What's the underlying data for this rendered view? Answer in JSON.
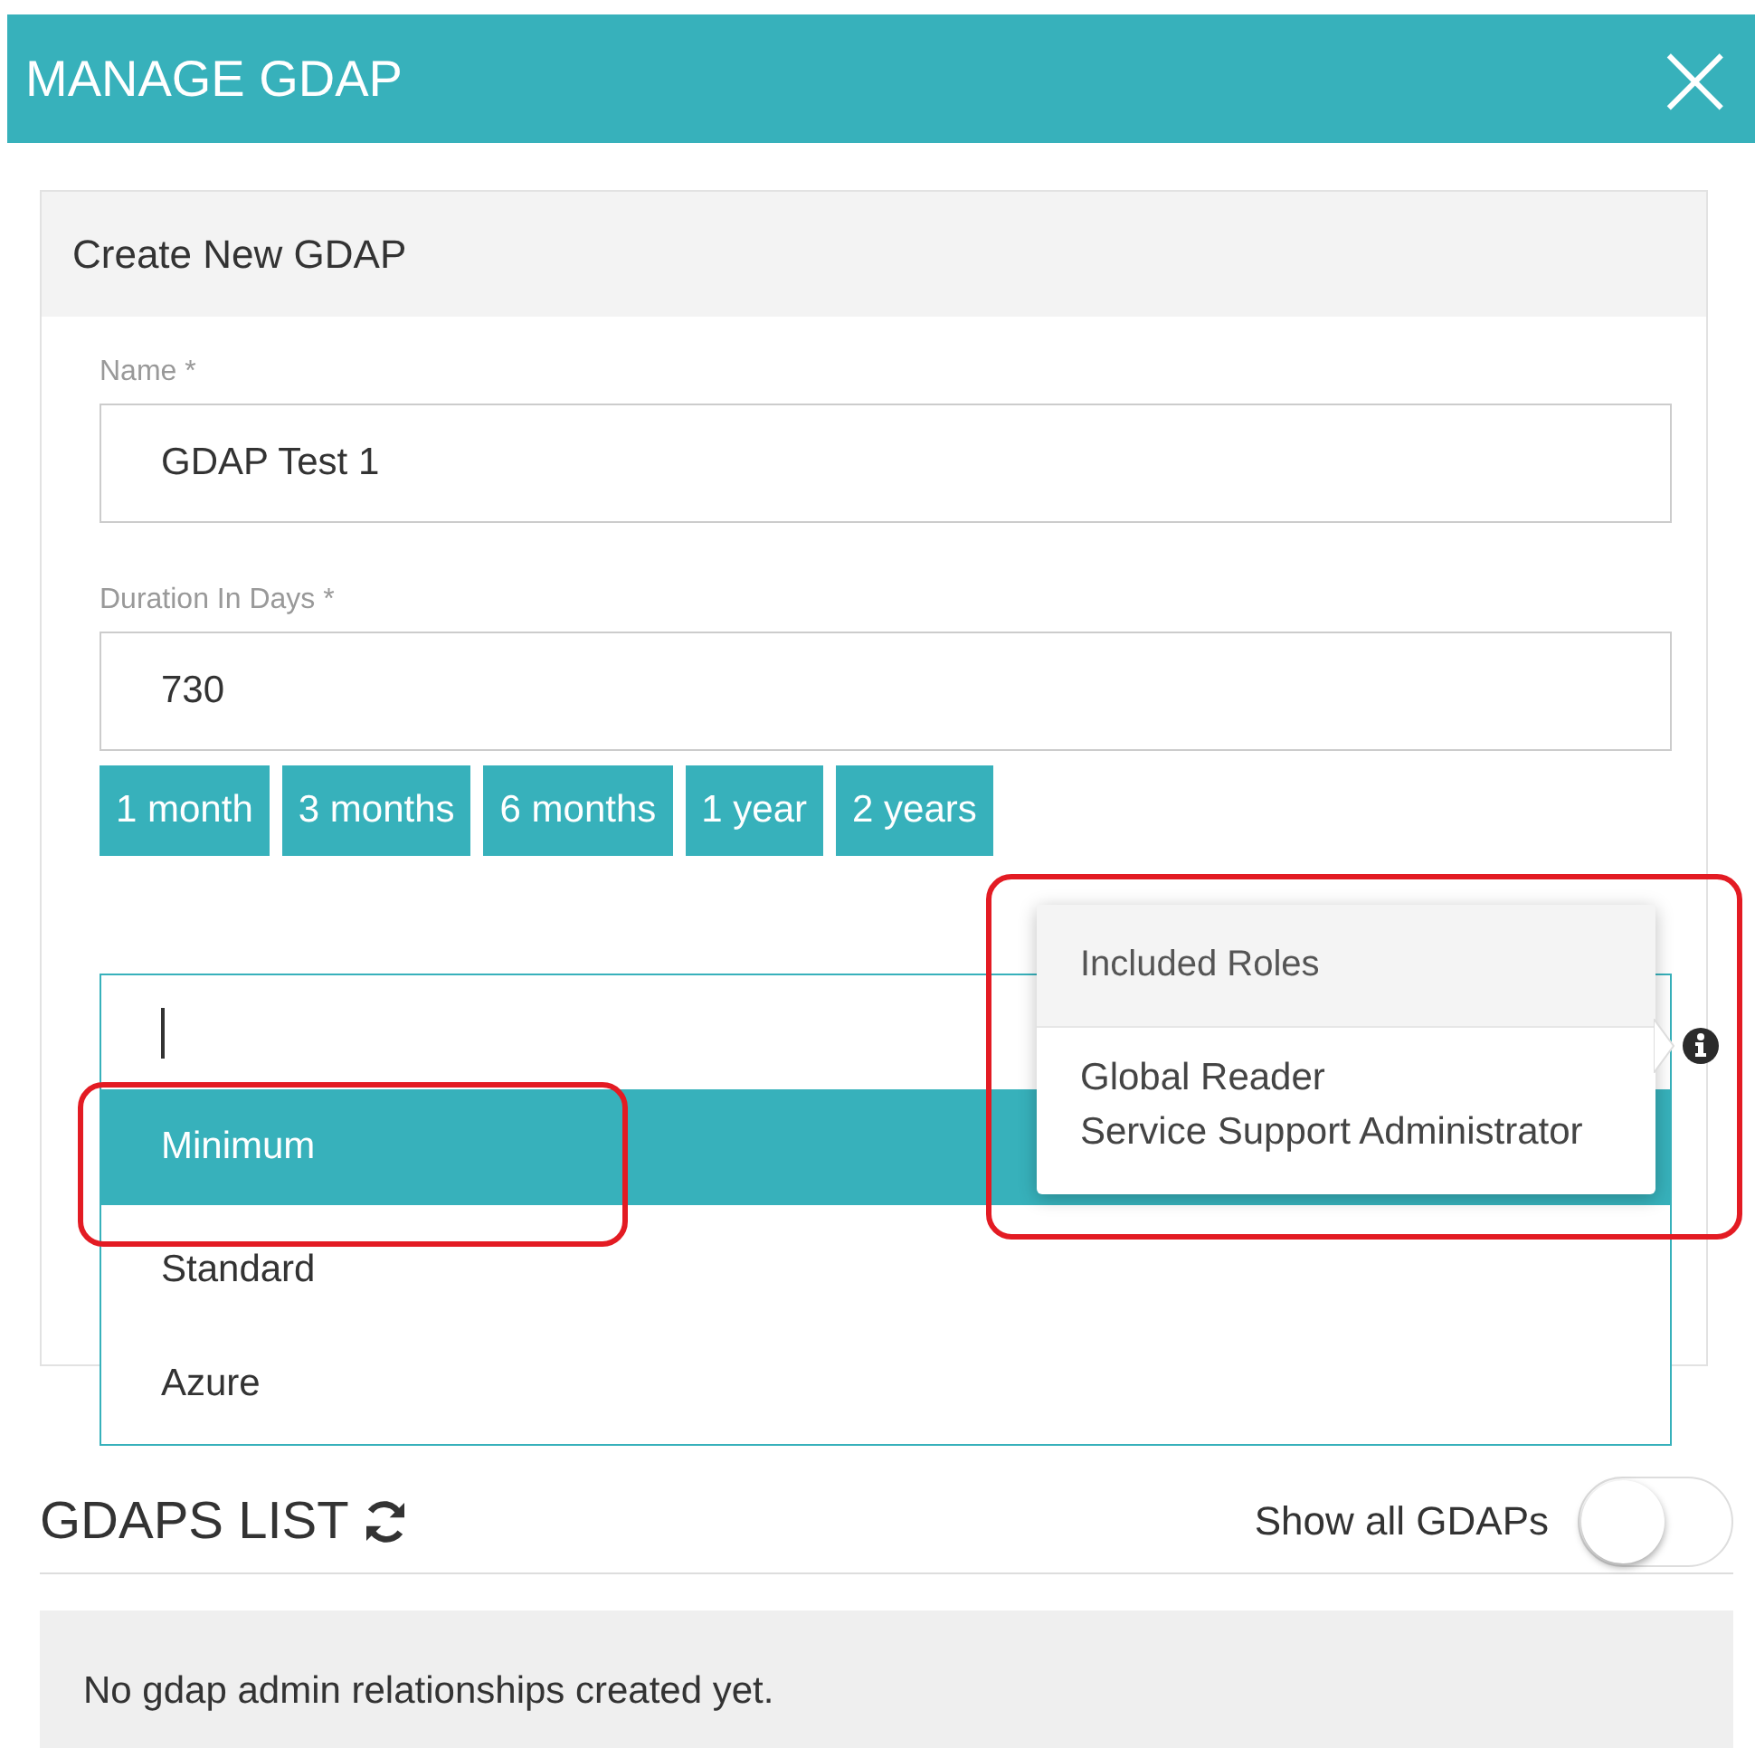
{
  "window": {
    "title": "MANAGE GDAP",
    "close": "×"
  },
  "form": {
    "title": "Create New GDAP",
    "fields": [
      {
        "label": "Name *",
        "value": "GDAP Test 1"
      },
      {
        "label": "Duration In Days *",
        "value": "730"
      }
    ],
    "duration_presets": [
      "1 month",
      "3 months",
      "6 months",
      "1 year",
      "2 years"
    ],
    "role_select": {
      "options": [
        {
          "label": "Minimum",
          "selected": true,
          "highlighted": true
        },
        {
          "label": "Standard",
          "selected": false,
          "highlighted": false
        },
        {
          "label": "Azure",
          "selected": false,
          "highlighted": false
        }
      ]
    },
    "tooltip": {
      "title": "Included Roles",
      "lines": [
        "Global Reader",
        "Service Support Administrator"
      ],
      "highlighted": true
    }
  },
  "list": {
    "title": "GDAPS LIST",
    "toggle_label": "Show all GDAPs",
    "toggle_on": false,
    "empty_message": "No gdap admin relationships created yet."
  }
}
